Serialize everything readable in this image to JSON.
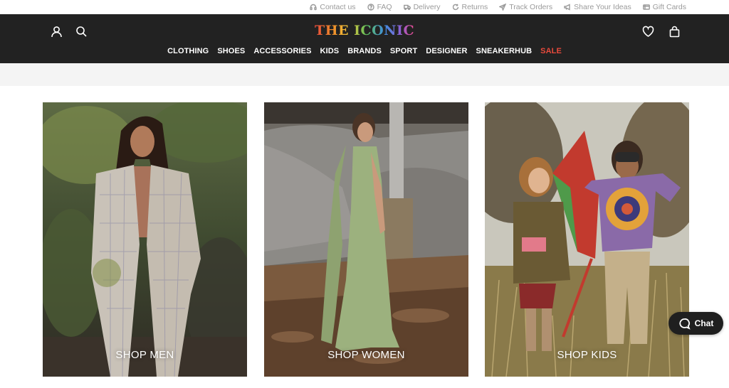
{
  "utility": {
    "links": [
      {
        "label": "Contact us",
        "icon": "headset-icon"
      },
      {
        "label": "FAQ",
        "icon": "question-icon"
      },
      {
        "label": "Delivery",
        "icon": "truck-icon"
      },
      {
        "label": "Returns",
        "icon": "returns-icon"
      },
      {
        "label": "Track Orders",
        "icon": "send-icon"
      },
      {
        "label": "Share Your Ideas",
        "icon": "megaphone-icon"
      },
      {
        "label": "Gift Cards",
        "icon": "gift-card-icon"
      }
    ]
  },
  "header": {
    "logo_text": "THE ICONIC",
    "icons_left": [
      "account-icon",
      "search-icon"
    ],
    "icons_right": [
      "wishlist-heart-icon",
      "shopping-bag-icon"
    ],
    "nav": [
      "CLOTHING",
      "SHOES",
      "ACCESSORIES",
      "KIDS",
      "BRANDS",
      "SPORT",
      "DESIGNER",
      "SNEAKERHUB",
      "SALE"
    ],
    "colors": {
      "background": "#222222",
      "sale": "#e84a3c"
    }
  },
  "tiles": [
    {
      "label": "SHOP MEN"
    },
    {
      "label": "SHOP WOMEN"
    },
    {
      "label": "SHOP KIDS"
    }
  ],
  "chat": {
    "label": "Chat",
    "icon": "chat-bubble-icon"
  }
}
